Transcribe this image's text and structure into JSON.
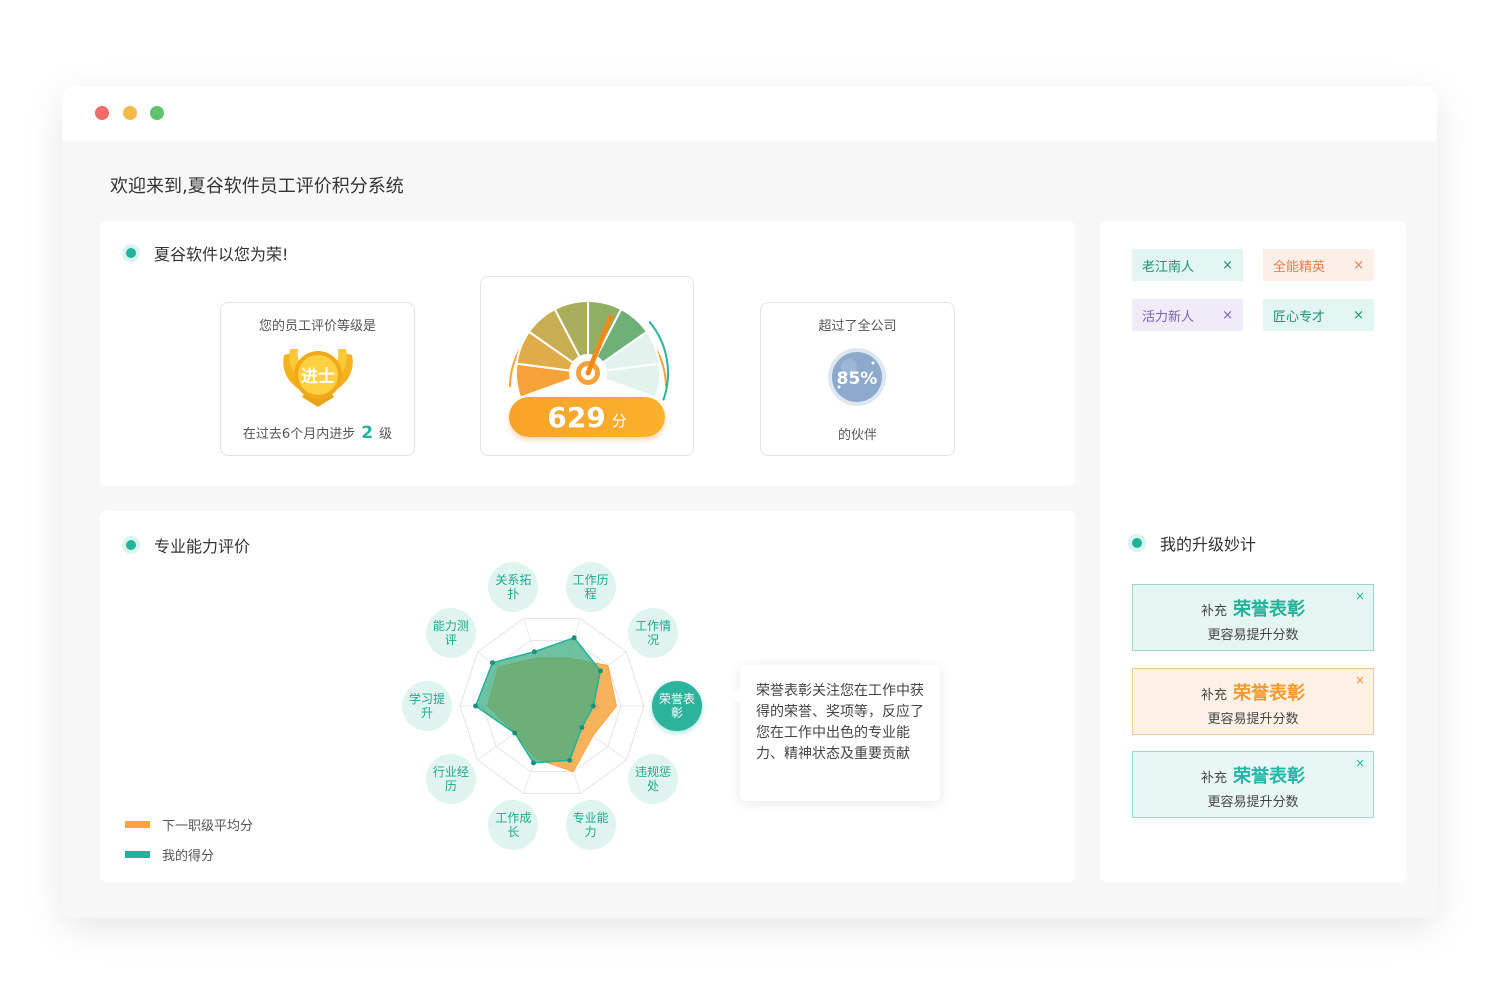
{
  "welcome": "欢迎来到,夏谷软件员工评价积分系统",
  "honor": {
    "title": "夏谷软件以您为荣!",
    "level": {
      "label": "您的员工评价等级是",
      "badge_text": "进士",
      "progress_prefix": "在过去6个月内进步",
      "progress_value": "2",
      "progress_suffix": "级"
    },
    "gauge": {
      "score": "629",
      "unit": "分",
      "fraction": 0.6
    },
    "rank": {
      "label": "超过了全公司",
      "percent": "85%",
      "suffix": "的伙伴"
    }
  },
  "tags": [
    {
      "label": "老江南人",
      "close": "×",
      "color": "green"
    },
    {
      "label": "全能精英",
      "close": "×",
      "color": "orange"
    },
    {
      "label": "活力新人",
      "close": "×",
      "color": "purple"
    },
    {
      "label": "匠心专才",
      "close": "×",
      "color": "green"
    }
  ],
  "ability": {
    "title": "专业能力评价",
    "nodes": [
      {
        "label": "工作历程",
        "active": false
      },
      {
        "label": "工作情况",
        "active": false
      },
      {
        "label": "荣誉表彰",
        "active": true
      },
      {
        "label": "违规惩处",
        "active": false
      },
      {
        "label": "专业能力",
        "active": false
      },
      {
        "label": "工作成长",
        "active": false
      },
      {
        "label": "行业经历",
        "active": false
      },
      {
        "label": "学习提升",
        "active": false
      },
      {
        "label": "能力测评",
        "active": false
      },
      {
        "label": "关系拓扑",
        "active": false
      }
    ],
    "tooltip": "荣誉表彰关注您在工作中获得的荣誉、奖项等，反应了您在工作中出色的专业能力、精神状态及重要贡献",
    "legend": [
      {
        "label": "下一职级平均分",
        "color": "#f7a540"
      },
      {
        "label": "我的得分",
        "color": "#1fb39a"
      }
    ],
    "series_next_level": [
      0.55,
      0.75,
      0.7,
      0.55,
      0.75,
      0.6,
      0.5,
      0.7,
      0.72,
      0.55
    ],
    "series_mine": [
      0.78,
      0.65,
      0.45,
      0.4,
      0.62,
      0.65,
      0.5,
      0.83,
      0.8,
      0.62
    ]
  },
  "upgrade": {
    "title": "我的升级妙计",
    "tips": [
      {
        "prefix": "补充",
        "highlight": "荣誉表彰",
        "line2": "更容易提升分数",
        "close": "×",
        "color": "green"
      },
      {
        "prefix": "补充",
        "highlight": "荣誉表彰",
        "line2": "更容易提升分数",
        "close": "×",
        "color": "orange"
      },
      {
        "prefix": "补充",
        "highlight": "荣誉表彰",
        "line2": "更容易提升分数",
        "close": "×",
        "color": "cyan"
      }
    ]
  }
}
